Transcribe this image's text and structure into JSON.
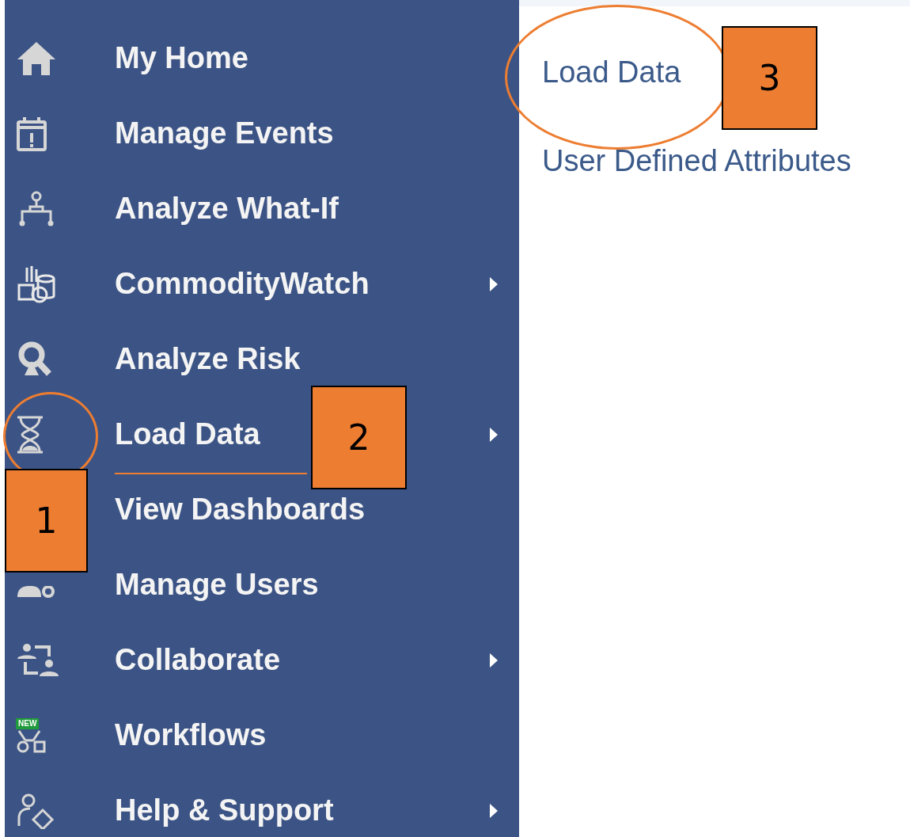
{
  "sidebar": {
    "items": [
      {
        "label": "My Home",
        "has_submenu": false
      },
      {
        "label": "Manage Events",
        "has_submenu": false
      },
      {
        "label": "Analyze What-If",
        "has_submenu": false
      },
      {
        "label": "CommodityWatch",
        "has_submenu": true
      },
      {
        "label": "Analyze Risk",
        "has_submenu": false
      },
      {
        "label": "Load Data",
        "has_submenu": true
      },
      {
        "label": "View Dashboards",
        "has_submenu": false
      },
      {
        "label": "Manage Users",
        "has_submenu": false
      },
      {
        "label": "Collaborate",
        "has_submenu": true
      },
      {
        "label": "Workflows",
        "has_submenu": false,
        "badge": "NEW"
      },
      {
        "label": "Help & Support",
        "has_submenu": true
      }
    ]
  },
  "submenu": {
    "items": [
      {
        "label": "Load Data"
      },
      {
        "label": "User Defined Attributes"
      }
    ]
  },
  "callouts": [
    {
      "label": "1"
    },
    {
      "label": "2"
    },
    {
      "label": "3"
    }
  ]
}
